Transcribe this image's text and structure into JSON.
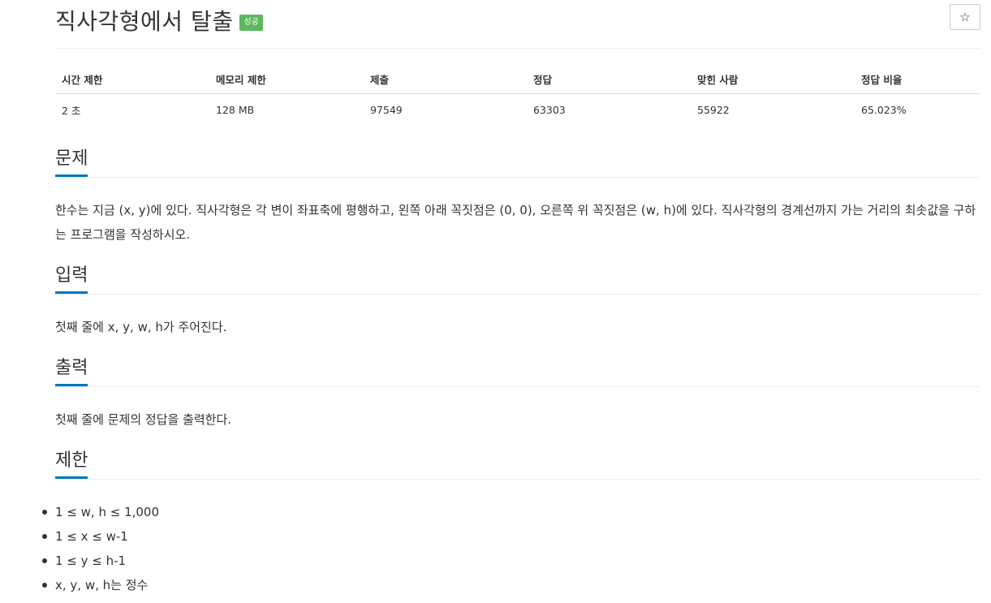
{
  "header": {
    "title": "직사각형에서 탈출",
    "badge": "성공",
    "star_icon": "☆"
  },
  "info_table": {
    "columns": [
      "시간 제한",
      "메모리 제한",
      "제출",
      "정답",
      "맞힌 사람",
      "정답 비율"
    ],
    "values": [
      "2 초",
      "128 MB",
      "97549",
      "63303",
      "55922",
      "65.023%"
    ]
  },
  "sections": {
    "problem": {
      "title": "문제",
      "text": "한수는 지금 (x, y)에 있다. 직사각형은 각 변이 좌표축에 평행하고, 왼쪽 아래 꼭짓점은 (0, 0), 오른쪽 위 꼭짓점은 (w, h)에 있다. 직사각형의 경계선까지 가는 거리의 최솟값을 구하는 프로그램을 작성하시오."
    },
    "input": {
      "title": "입력",
      "text": "첫째 줄에 x, y, w, h가 주어진다."
    },
    "output": {
      "title": "출력",
      "text": "첫째 줄에 문제의 정답을 출력한다."
    },
    "limits": {
      "title": "제한",
      "items": [
        "1 ≤ w, h ≤ 1,000",
        "1 ≤ x ≤ w-1",
        "1 ≤ y ≤ h-1",
        "x, y, w, h는 정수"
      ]
    }
  },
  "colors": {
    "badge_bg": "#5cb85c",
    "section_underline": "#0076c0",
    "text": "#333333"
  }
}
